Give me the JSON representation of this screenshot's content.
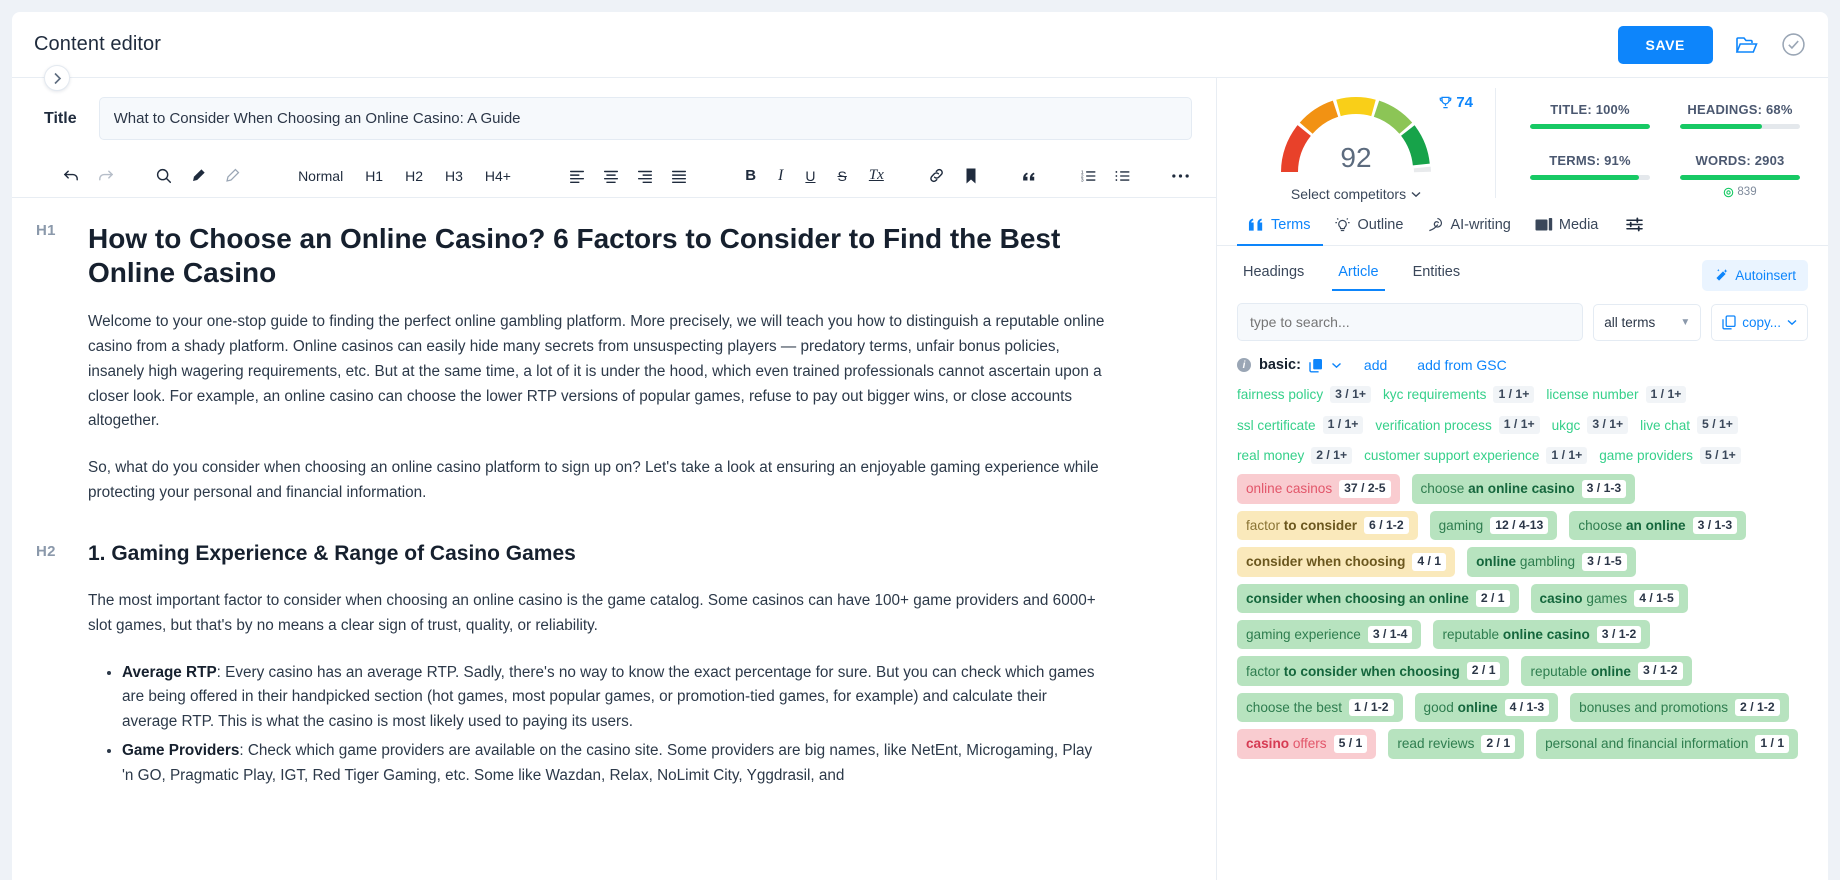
{
  "app": {
    "title": "Content editor"
  },
  "topbar": {
    "save_label": "SAVE",
    "open_icon": "folder-open-icon",
    "status_icon": "check-circle-icon"
  },
  "editor": {
    "title_label": "Title",
    "title_value": "What to Consider When Choosing an Online Casino: A Guide",
    "toolbar": {
      "undo": "undo-icon",
      "redo": "redo-icon",
      "search": "search-icon",
      "highlight": "marker-icon",
      "eraser": "erase-format-icon",
      "normal": "Normal",
      "h1": "H1",
      "h2": "H2",
      "h3": "H3",
      "h4plus": "H4+",
      "align_left": "align-left-icon",
      "align_center": "align-center-icon",
      "align_right": "align-right-icon",
      "align_justify": "align-justify-icon",
      "bold": "B",
      "italic": "I",
      "underline": "U",
      "strike": "S",
      "clear_format": "Tx",
      "link": "link-icon",
      "bookmark": "bookmark-icon",
      "quote": "quote-icon",
      "ordered_list": "ordered-list-icon",
      "bullet_list": "bullet-list-icon",
      "more": "more-horizontal-icon"
    },
    "document": {
      "h1_marker": "H1",
      "h1": "How to Choose an Online Casino? 6 Factors to Consider to Find the Best Online Casino",
      "p1": "Welcome to your one-stop guide to finding the perfect online gambling platform. More precisely, we will teach you how to distinguish a reputable online casino from a shady platform. Online casinos can easily hide many secrets from unsuspecting players — predatory terms, unfair bonus policies, insanely high wagering requirements, etc. But at the same time, a lot of it is under the hood, which even trained professionals cannot ascertain upon a closer look. For example, an online casino can choose the lower RTP versions of popular games, refuse to pay out bigger wins, or close accounts altogether.",
      "p2": "So, what do you consider when choosing an online casino platform to sign up on? Let's take a look at ensuring an enjoyable gaming experience while protecting your personal and financial information.",
      "h2_marker": "H2",
      "h2": "1. Gaming Experience & Range of Casino Games",
      "p3": "The most important factor to consider when choosing an online casino is the game catalog. Some casinos can have 100+ game providers and 6000+ slot games, but that's by no means a clear sign of trust, quality, or reliability.",
      "bullets": [
        {
          "term": "Average RTP",
          "text": ": Every casino has an average RTP. Sadly, there's no way to know the exact percentage for sure. But you can check which games are being offered in their handpicked section (hot games, most popular games, or promotion-tied games, for example) and calculate their average RTP. This is what the casino is most likely used to paying its users."
        },
        {
          "term": "Game Providers",
          "text": ": Check which game providers are available on the casino site. Some providers are big names, like NetEnt, Microgaming, Play 'n GO, Pragmatic Play, IGT, Red Tiger Gaming, etc. Some like Wazdan, Relax, NoLimit City, Yggdrasil, and"
        }
      ]
    }
  },
  "score": {
    "value": "92",
    "trophy_value": "74",
    "select_competitors": "Select competitors",
    "metrics": [
      {
        "label": "TITLE: 100%",
        "percent": 100
      },
      {
        "label": "HEADINGS: 68%",
        "percent": 68
      },
      {
        "label": "TERMS: 91%",
        "percent": 91
      },
      {
        "label": "WORDS: 2903",
        "percent": 100
      }
    ],
    "words_target": "839"
  },
  "side": {
    "tabs": [
      {
        "label": "Terms",
        "icon": "quote-double-icon",
        "active": true
      },
      {
        "label": "Outline",
        "icon": "lightbulb-icon",
        "active": false
      },
      {
        "label": "AI-writing",
        "icon": "pen-icon",
        "active": false
      },
      {
        "label": "Media",
        "icon": "image-icon",
        "active": false
      }
    ],
    "settings_icon": "sliders-icon",
    "subtabs": [
      {
        "label": "Headings",
        "active": false
      },
      {
        "label": "Article",
        "active": true
      },
      {
        "label": "Entities",
        "active": false
      }
    ],
    "autoinsert_label": "Autoinsert",
    "search_placeholder": "type to search...",
    "filter_value": "all terms",
    "copy_label": "copy...",
    "basic_label": "basic:",
    "add_label": "add",
    "add_gsc_label": "add from GSC",
    "terms": [
      {
        "style": "plain",
        "text": "fairness policy",
        "count": "3 / 1+"
      },
      {
        "style": "plain",
        "text": "kyc requirements",
        "count": "1 / 1+"
      },
      {
        "style": "plain",
        "text": "license number",
        "count": "1 / 1+"
      },
      {
        "style": "plain",
        "text": "ssl certificate",
        "count": "1 / 1+"
      },
      {
        "style": "plain",
        "text": "verification process",
        "count": "1 / 1+"
      },
      {
        "style": "plain",
        "text": "ukgc",
        "count": "3 / 1+"
      },
      {
        "style": "plain",
        "text": "live chat",
        "count": "5 / 1+"
      },
      {
        "style": "plain",
        "text": "real money",
        "count": "2 / 1+"
      },
      {
        "style": "plain",
        "text": "customer support experience",
        "count": "1 / 1+"
      },
      {
        "style": "plain",
        "text": "game providers",
        "count": "5 / 1+"
      },
      {
        "style": "red",
        "text": "online casinos",
        "bold": "",
        "count": "37 / 2-5"
      },
      {
        "style": "green",
        "text": "choose ",
        "bold": "an online casino",
        "count": "3 / 1-3"
      },
      {
        "style": "yellow",
        "text": "factor ",
        "bold": "to consider",
        "count": "6 / 1-2"
      },
      {
        "style": "green",
        "text": "gaming",
        "bold": "",
        "count": "12 / 4-13"
      },
      {
        "style": "green",
        "text": "choose ",
        "bold": "an online",
        "count": "3 / 1-3"
      },
      {
        "style": "yellow",
        "text": "",
        "bold": "consider when choosing",
        "count": "4 / 1"
      },
      {
        "style": "green",
        "text": "",
        "bold": "online",
        "suffix": " gambling",
        "count": "3 / 1-5"
      },
      {
        "style": "green",
        "text": "",
        "bold": "consider when choosing an online",
        "count": "2 / 1"
      },
      {
        "style": "green",
        "text": "",
        "bold": "casino",
        "suffix": " games",
        "count": "4 / 1-5"
      },
      {
        "style": "green",
        "text": "gaming experience",
        "bold": "",
        "count": "3 / 1-4"
      },
      {
        "style": "green",
        "text": "reputable ",
        "bold": "online casino",
        "count": "3 / 1-2"
      },
      {
        "style": "green",
        "text": "factor ",
        "bold": "to consider when choosing",
        "count": "2 / 1"
      },
      {
        "style": "green",
        "text": "reputable ",
        "bold": "online",
        "count": "3 / 1-2"
      },
      {
        "style": "green",
        "text": "choose the best",
        "bold": "",
        "count": "1 / 1-2"
      },
      {
        "style": "green",
        "text": "good ",
        "bold": "online",
        "count": "4 / 1-3"
      },
      {
        "style": "green",
        "text": "bonuses and promotions",
        "bold": "",
        "count": "2 / 1-2"
      },
      {
        "style": "red",
        "text": "",
        "bold": "casino",
        "suffix": " offers",
        "count": "5 / 1"
      },
      {
        "style": "green",
        "text": "read reviews",
        "bold": "",
        "count": "2 / 1"
      },
      {
        "style": "green",
        "text": "personal and financial information",
        "bold": "",
        "count": "1 / 1"
      }
    ]
  }
}
